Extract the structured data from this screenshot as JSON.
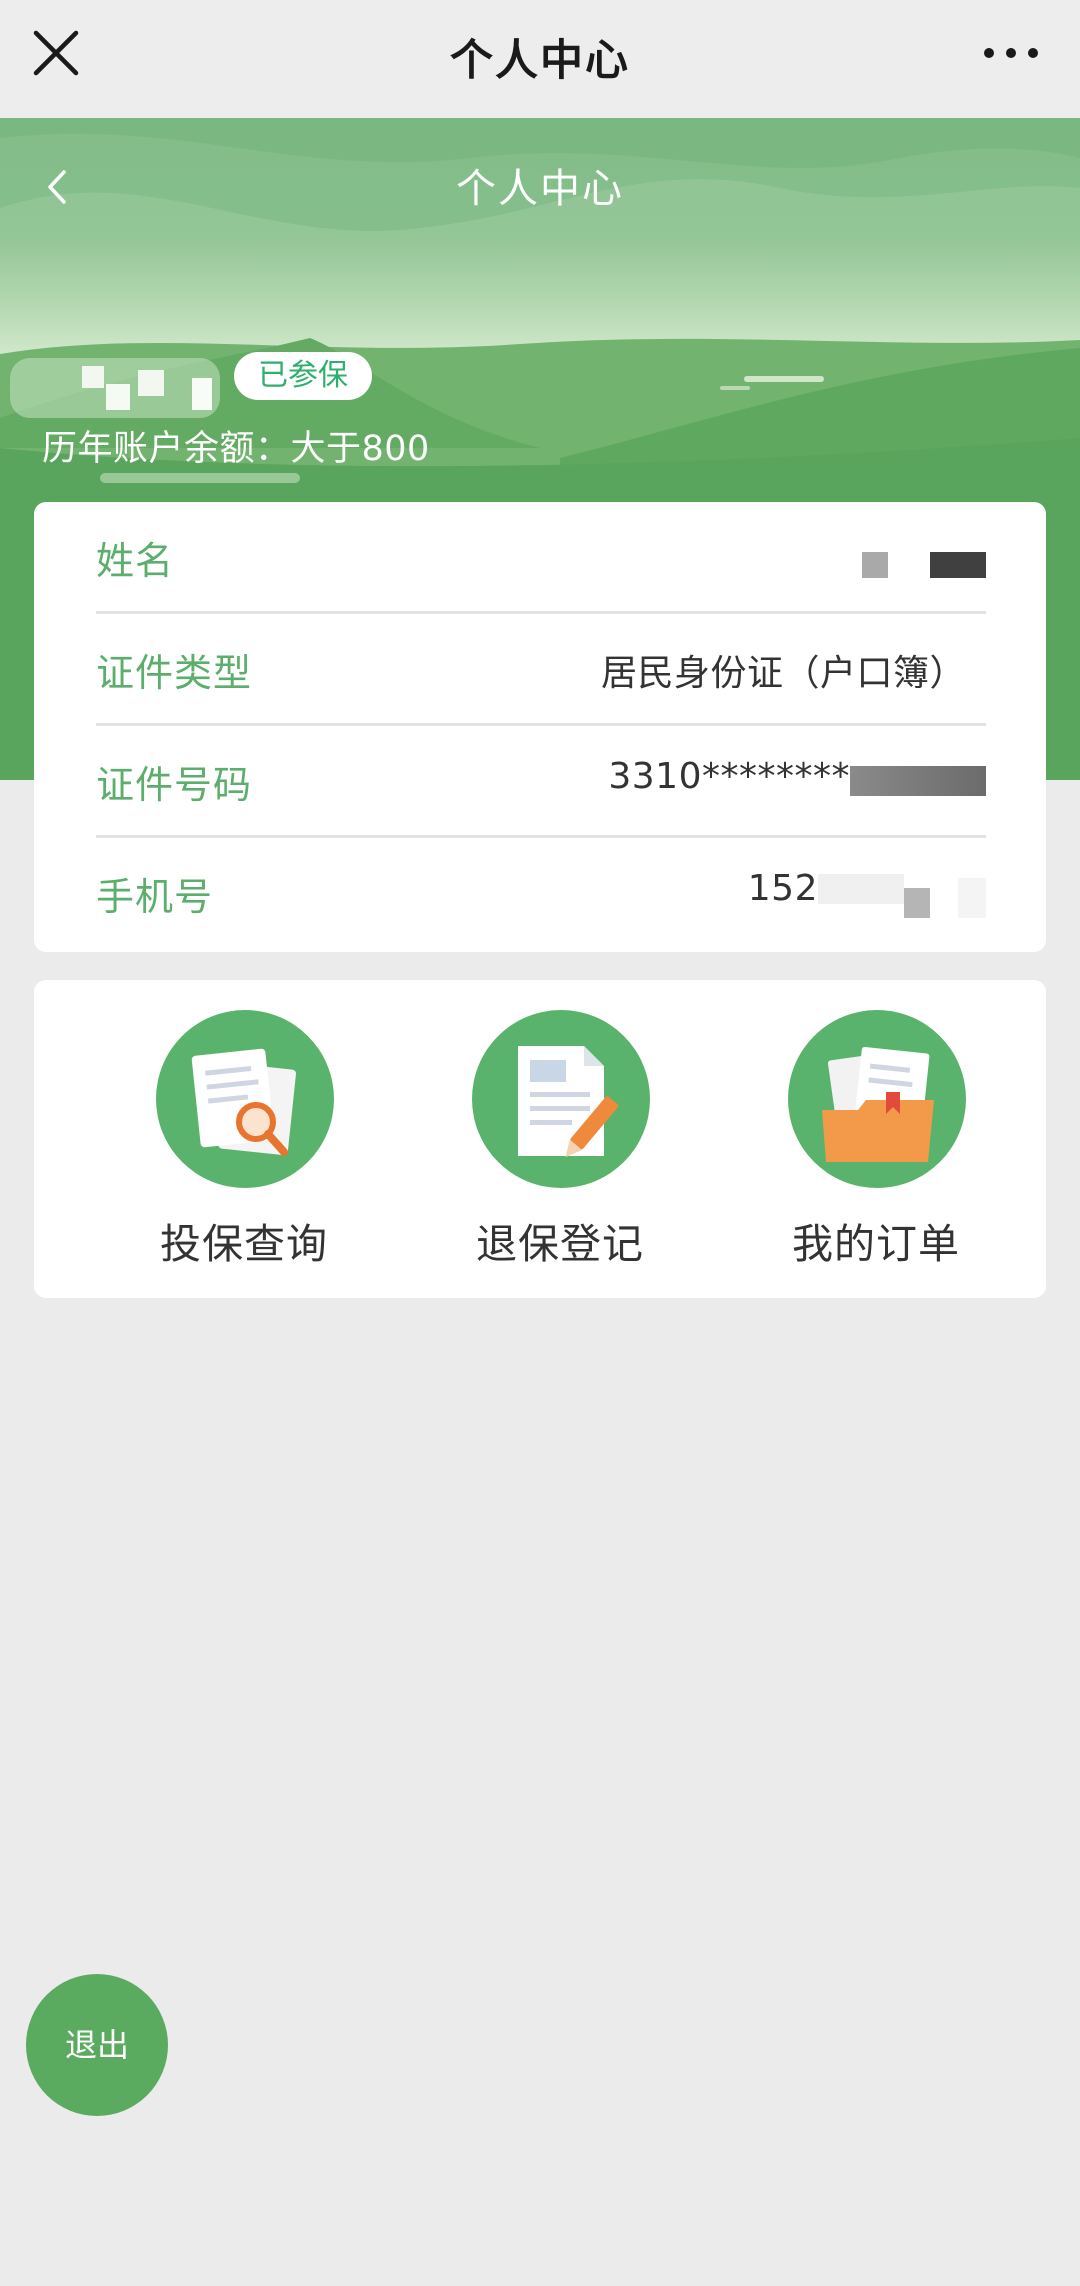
{
  "topbar": {
    "title": "个人中心",
    "close_icon": "close-icon",
    "more_icon": "more-dots-icon"
  },
  "hero": {
    "title": "个人中心",
    "back_icon": "chevron-left-icon",
    "badge": "已参保",
    "balance": "历年账户余额：大于800",
    "colors": {
      "sky": "#8cc08f",
      "hill": "#5faa62",
      "accent": "#2faf6e"
    }
  },
  "info": [
    {
      "label": "姓名",
      "value": ""
    },
    {
      "label": "证件类型",
      "value": "居民身份证（户口簿）"
    },
    {
      "label": "证件号码",
      "value": "3310********"
    },
    {
      "label": "手机号",
      "value": "152"
    }
  ],
  "actions": [
    {
      "label": "投保查询",
      "icon": "document-search-icon"
    },
    {
      "label": "退保登记",
      "icon": "document-edit-icon"
    },
    {
      "label": "我的订单",
      "icon": "folder-orders-icon"
    }
  ],
  "logout": {
    "label": "退出"
  }
}
